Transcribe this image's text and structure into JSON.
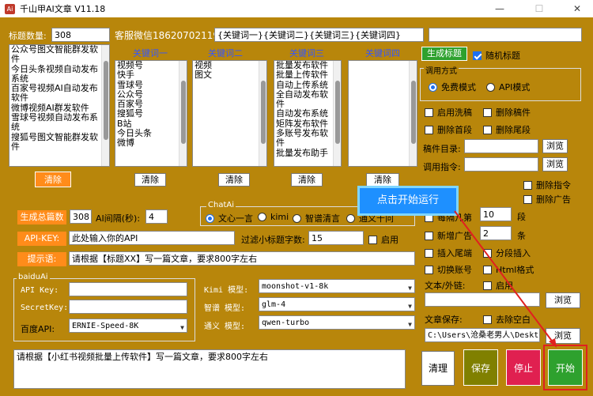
{
  "window": {
    "title": "千山甲AI文章 V11.18",
    "minimize": "—",
    "maximize": "☐",
    "close": "✕"
  },
  "top": {
    "title_count_label": "标题数量:",
    "title_count_value": "308",
    "contact": "客服微信18620702119",
    "keyword_template": "{关键词一}{关键词二}{关键词三}{关键词四}",
    "extra_input": ""
  },
  "title_list": [
    "公众号图文智能群发软",
    "件",
    "今日头条视频自动发布",
    "系统",
    "百家号视频AI自动发布",
    "软件",
    "微博视频AI群发软件",
    "雪球号视频自动发布系",
    "统",
    "搜狐号图文智能群发软",
    "件"
  ],
  "keyword_columns": [
    {
      "header": "关键词一",
      "items": [
        "视频号",
        "快手",
        "雪球号",
        "公众号",
        "百家号",
        "搜狐号",
        "B站",
        "今日头条",
        "微博"
      ]
    },
    {
      "header": "关键词二",
      "items": [
        "视频",
        "图文"
      ]
    },
    {
      "header": "关键词三",
      "items": [
        "批量发布软件",
        "批量上传软件",
        "自动上传系统",
        "全自动发布软",
        "件",
        "自动发布系统",
        "矩阵发布软件",
        "多账号发布软",
        "件",
        "批量发布助手"
      ]
    },
    {
      "header": "关键词四",
      "items": []
    }
  ],
  "clear_buttons": [
    "清除",
    "清除",
    "清除",
    "清除",
    "清除"
  ],
  "right_top": {
    "generate_title": "生成标题",
    "random_title": "随机标题",
    "call_mode_title": "调用方式",
    "mode_free": "免费模式",
    "mode_api": "API模式",
    "enable_wash": "启用洗稿",
    "delete_draft": "删除稿件",
    "delete_first_para": "删除首段",
    "delete_last_para": "删除尾段",
    "draft_dir_label": "稿件目录:",
    "call_cmd_label": "调用指令:",
    "browse": "浏览",
    "delete_cmd": "删除指令",
    "delete_ad": "删除广告"
  },
  "mid": {
    "gen_total_label": "生成总篇数",
    "gen_total_value": "308",
    "interval_label": "AI间隔(秒):",
    "interval_value": "4",
    "chatai_title": "ChatAi",
    "chatai_options": [
      "文心一言",
      "kimi",
      "智谱清言",
      "通义千问"
    ],
    "api_key_label": "API-KEY:",
    "api_key_value": "此处输入你的API",
    "filter_label": "过滤小标题字数:",
    "filter_value": "15",
    "filter_enable": "启用",
    "prompt_label": "提示语:",
    "prompt_value": "请根据【标题XX】写一篇文章，要求800字左右"
  },
  "baidu": {
    "title": "baiduAi",
    "api_key_label": "API Key:",
    "secret_label": "SecretKey:",
    "baidu_api_label": "百度API:",
    "baidu_api_value": "ERNIE-Speed-8K"
  },
  "models": {
    "kimi_label": "Kimi 模型:",
    "kimi_value": "moonshot-v1-8k",
    "zhipu_label": "智谱 模型:",
    "zhipu_value": "glm-4",
    "tongyi_label": "通义 模型:",
    "tongyi_value": "qwen-turbo"
  },
  "right_mid": {
    "per_n_label": "每隔几第",
    "per_n_value": "10",
    "per_n_unit": "段",
    "add_ad_label": "新增广告",
    "add_ad_value": "2",
    "add_ad_unit": "条",
    "insert_tail": "插入尾端",
    "segment_insert": "分段插入",
    "switch_account": "切换账号",
    "html_format": "Html格式",
    "text_img_label": "文本/外链:",
    "text_img_enable": "启用",
    "save_label": "文章保存:",
    "remove_blank": "去除空白",
    "save_path": "C:\\Users\\沧桑老男人\\Deskto"
  },
  "bottom": {
    "preview_text": "请根据【小红书视频批量上传软件】写一篇文章，要求800字左右",
    "clear": "清理",
    "save": "保存",
    "stop": "停止",
    "start": "开始"
  },
  "annotation": {
    "callout": "点击开始运行"
  },
  "colors": {
    "bg": "#b8860b",
    "orange": "#ff8c1a",
    "green": "#2ea12e",
    "red": "#e02050",
    "olive": "#808000"
  }
}
